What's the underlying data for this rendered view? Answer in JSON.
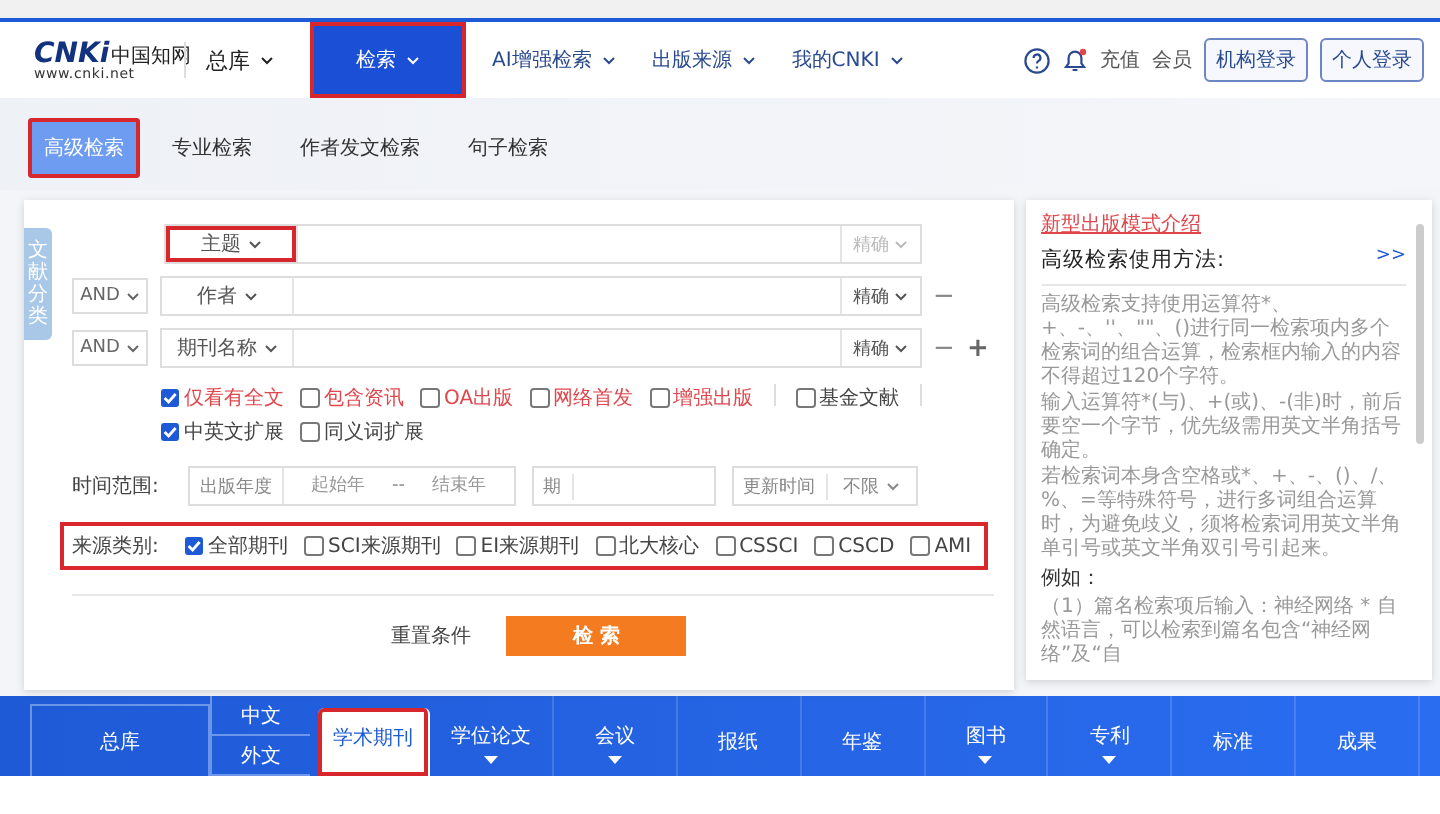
{
  "header": {
    "logo": {
      "mark": "CNKi",
      "name": "中国知网",
      "url": "www.cnki.net"
    },
    "library": "总库",
    "nav": [
      {
        "label": "检索",
        "selected": true,
        "highlighted": true
      },
      {
        "label": "AI增强检索",
        "selected": false,
        "highlighted": false
      },
      {
        "label": "出版来源",
        "selected": false,
        "highlighted": false
      },
      {
        "label": "我的CNKI",
        "selected": false,
        "highlighted": false
      }
    ],
    "links": [
      "充值",
      "会员"
    ],
    "buttons": [
      "机构登录",
      "个人登录"
    ]
  },
  "search_tabs": [
    {
      "label": "高级检索",
      "selected": true,
      "highlighted": true
    },
    {
      "label": "专业检索",
      "selected": false,
      "highlighted": false
    },
    {
      "label": "作者发文检索",
      "selected": false,
      "highlighted": false
    },
    {
      "label": "句子检索",
      "selected": false,
      "highlighted": false
    }
  ],
  "side_tab": "文献分类",
  "query_rows": [
    {
      "field": "主题",
      "match": "精确",
      "match_disabled": true,
      "highlighted": true,
      "actions": []
    },
    {
      "logic": "AND",
      "field": "作者",
      "match": "精确",
      "match_disabled": false,
      "highlighted": false,
      "actions": [
        {
          "kind": "remove",
          "symbol": "−"
        }
      ]
    },
    {
      "logic": "AND",
      "field": "期刊名称",
      "match": "精确",
      "match_disabled": false,
      "highlighted": false,
      "actions": [
        {
          "kind": "remove",
          "symbol": "−"
        },
        {
          "kind": "add",
          "symbol": "+"
        }
      ]
    }
  ],
  "options": [
    {
      "label": "仅看有全文",
      "checked": true,
      "color": "#e0474c",
      "divider_before": false
    },
    {
      "label": "包含资讯",
      "checked": false,
      "color": "#e0474c",
      "divider_before": false
    },
    {
      "label": "OA出版",
      "checked": false,
      "color": "#e0474c",
      "divider_before": false
    },
    {
      "label": "网络首发",
      "checked": false,
      "color": "#e0474c",
      "divider_before": false
    },
    {
      "label": "增强出版",
      "checked": false,
      "color": "#e0474c",
      "divider_before": false
    },
    {
      "label": "基金文献",
      "checked": false,
      "color": "#444444",
      "divider_before": true
    },
    {
      "label": "中英文扩展",
      "checked": true,
      "color": "#444444",
      "divider_before": true
    },
    {
      "label": "同义词扩展",
      "checked": false,
      "color": "#444444",
      "divider_before": false
    }
  ],
  "time_range": {
    "label": "时间范围:",
    "year_type": "出版年度",
    "from_placeholder": "起始年",
    "separator": "--",
    "to_placeholder": "结束年",
    "issue_label": "期",
    "update_label": "更新时间",
    "update_value": "不限"
  },
  "source": {
    "label": "来源类别:",
    "highlighted": true,
    "options": [
      {
        "label": "全部期刊",
        "checked": true
      },
      {
        "label": "SCI来源期刊",
        "checked": false
      },
      {
        "label": "EI来源期刊",
        "checked": false
      },
      {
        "label": "北大核心",
        "checked": false
      },
      {
        "label": "CSSCI",
        "checked": false
      },
      {
        "label": "CSCD",
        "checked": false
      },
      {
        "label": "AMI",
        "checked": false
      }
    ]
  },
  "actions": {
    "reset": "重置条件",
    "search": "检 索"
  },
  "help": {
    "link": "新型出版模式介绍",
    "title": "高级检索使用方法:",
    "more": ">>",
    "paragraphs": [
      "高级检索支持使用运算符*、+、-、''、\"\"、()进行同一检索项内多个检索词的组合运算，检索框内输入的内容不得超过120个字符。",
      "输入运算符*(与)、+(或)、-(非)时，前后要空一个字节，优先级需用英文半角括号确定。",
      "若检索词本身含空格或*、+、-、()、/、%、=等特殊符号，进行多词组合运算时，为避免歧义，须将检索词用英文半角单引号或英文半角双引号引起来。"
    ],
    "example_title": "例如：",
    "example": "（1）篇名检索项后输入：神经网络 * 自然语言，可以检索到篇名包含“神经网络”及“自"
  },
  "bottom_nav": {
    "library": "总库",
    "languages": [
      "中文",
      "外文"
    ],
    "tabs": [
      {
        "label": "学术期刊",
        "selected": true,
        "highlighted": true,
        "has_menu": false
      },
      {
        "label": "学位论文",
        "selected": false,
        "highlighted": false,
        "has_menu": true
      },
      {
        "label": "会议",
        "selected": false,
        "highlighted": false,
        "has_menu": true
      },
      {
        "label": "报纸",
        "selected": false,
        "highlighted": false,
        "has_menu": false
      },
      {
        "label": "年鉴",
        "selected": false,
        "highlighted": false,
        "has_menu": false
      },
      {
        "label": "图书",
        "selected": false,
        "highlighted": false,
        "has_menu": true
      },
      {
        "label": "专利",
        "selected": false,
        "highlighted": false,
        "has_menu": true
      },
      {
        "label": "标准",
        "selected": false,
        "highlighted": false,
        "has_menu": false
      },
      {
        "label": "成果",
        "selected": false,
        "highlighted": false,
        "has_menu": false
      }
    ]
  }
}
